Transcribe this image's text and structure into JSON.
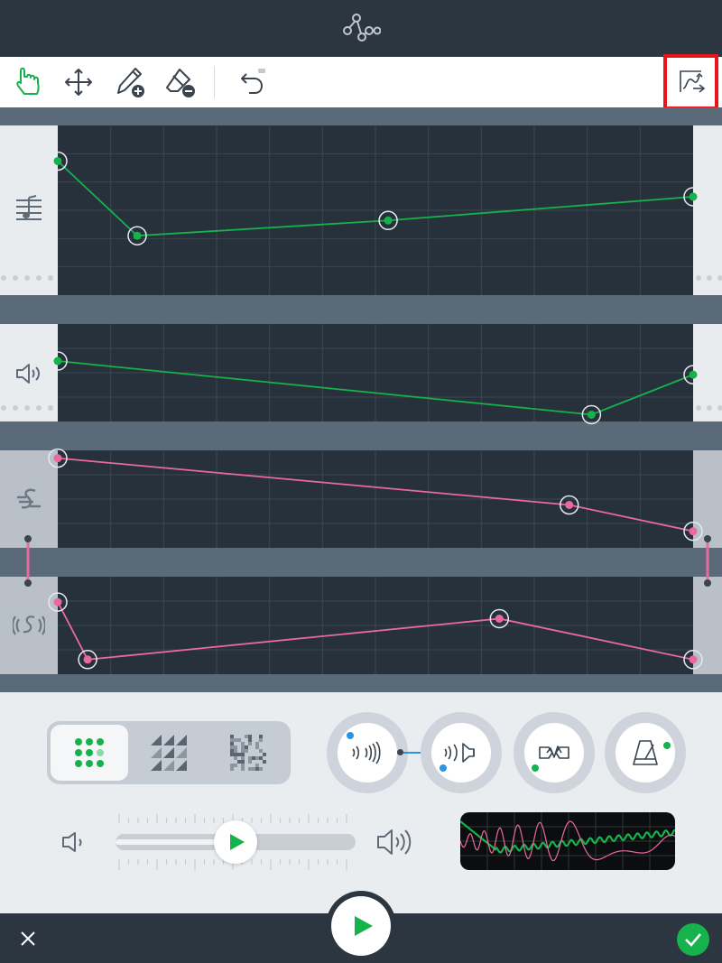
{
  "app": {
    "header_icon": "curve-nodes-icon"
  },
  "toolbar": {
    "tools": [
      {
        "name": "pointer-tool",
        "icon": "hand-pointer-icon",
        "active": true
      },
      {
        "name": "move-tool",
        "icon": "move-arrows-icon",
        "active": false
      },
      {
        "name": "add-point-tool",
        "icon": "pencil-add-icon",
        "active": false
      },
      {
        "name": "erase-point-tool",
        "icon": "eraser-remove-icon",
        "active": false
      },
      {
        "name": "undo-button",
        "icon": "undo-icon",
        "active": false
      }
    ],
    "right_tool": {
      "name": "curve-mode-button",
      "icon": "curve-mode-icon",
      "highlighted": true
    }
  },
  "lanes": [
    {
      "id": "pitch",
      "icon": "music-notes-icon",
      "color": "#16b24b",
      "points": [
        [
          0,
          0.21
        ],
        [
          0.125,
          0.65
        ],
        [
          0.52,
          0.56
        ],
        [
          1,
          0.42
        ]
      ]
    },
    {
      "id": "volume",
      "icon": "speaker-icon",
      "color": "#16b24b",
      "points": [
        [
          0,
          0.38
        ],
        [
          0.84,
          0.93
        ],
        [
          1,
          0.52
        ]
      ]
    },
    {
      "id": "tempo",
      "icon": "music-swirl-icon",
      "color": "#ea6a9d",
      "points": [
        [
          0,
          0.08
        ],
        [
          0.805,
          0.56
        ],
        [
          1,
          0.83
        ]
      ]
    },
    {
      "id": "echo",
      "icon": "sound-wave-icon",
      "color": "#ea6a9d",
      "points": [
        [
          0,
          0.26
        ],
        [
          0.047,
          0.85
        ],
        [
          0.695,
          0.43
        ],
        [
          1,
          0.85
        ]
      ]
    }
  ],
  "colors": {
    "accent_green": "#16b24b",
    "accent_pink": "#ea6a9d",
    "dot_blue": "#2b93e3",
    "highlight_red": "#e8161b"
  },
  "modes": [
    {
      "name": "dot-grid-mode",
      "icon": "dot-grid-icon",
      "active": true
    },
    {
      "name": "triangle-pattern-mode",
      "icon": "triangle-pattern-icon",
      "active": false
    },
    {
      "name": "noise-pattern-mode",
      "icon": "noise-pattern-icon",
      "active": false
    }
  ],
  "effect_knobs": [
    {
      "name": "reverb-knob",
      "icon": "reverb-waves-icon",
      "dot": "blue"
    },
    {
      "name": "speaker-echo-knob",
      "icon": "speaker-echo-icon",
      "dot": "blue"
    },
    {
      "name": "distortion-knob",
      "icon": "distortion-icon",
      "dot": "green"
    },
    {
      "name": "metronome-knob",
      "icon": "metronome-icon",
      "dot": "green"
    }
  ],
  "volume_slider": {
    "value": 0.5
  },
  "footer": {
    "close_icon": "close-icon",
    "play_icon": "play-icon",
    "confirm_icon": "check-icon"
  }
}
